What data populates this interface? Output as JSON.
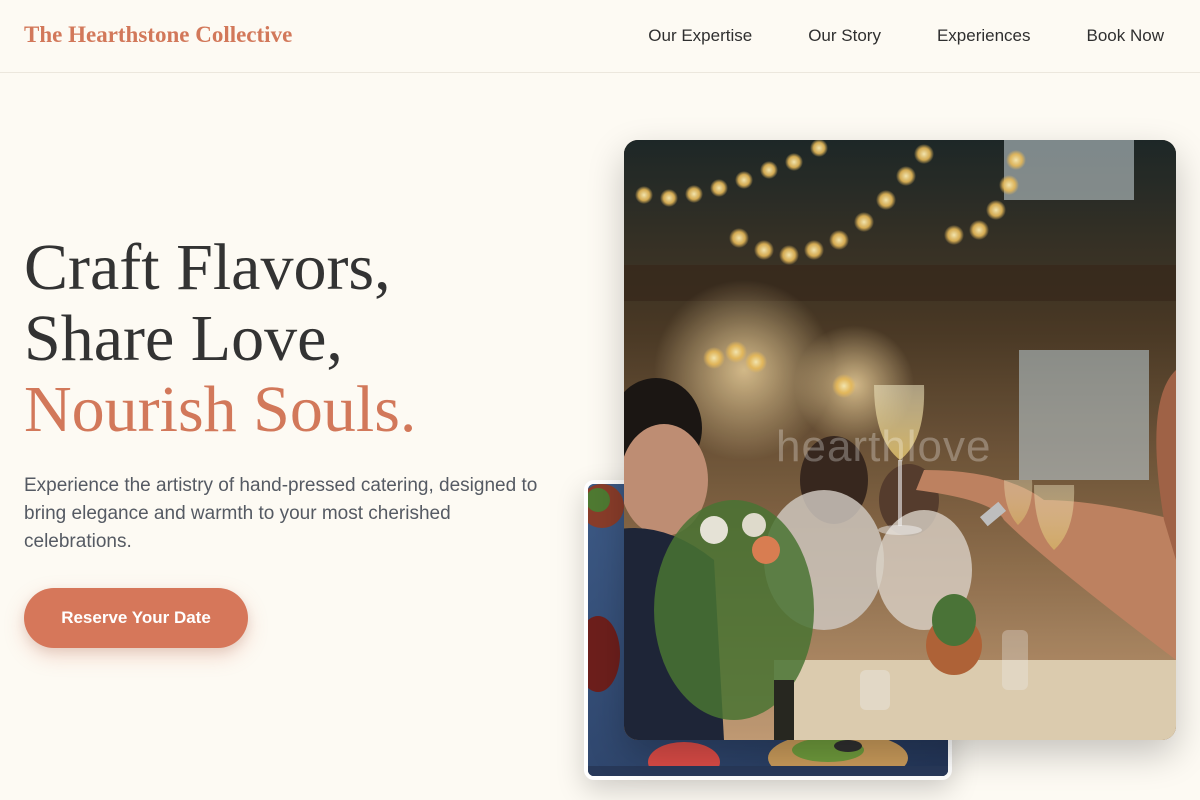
{
  "header": {
    "brand": "The Hearthstone Collective",
    "nav": [
      {
        "label": "Our Expertise"
      },
      {
        "label": "Our Story"
      },
      {
        "label": "Experiences"
      },
      {
        "label": "Book Now"
      }
    ]
  },
  "hero": {
    "title_line1": "Craft Flavors,",
    "title_line2": "Share Love,",
    "title_line3": "Nourish Souls.",
    "subtitle": "Experience the artistry of hand-pressed catering, designed to bring elegance and warmth to your most cherished celebrations.",
    "cta_label": "Reserve Your Date"
  },
  "images": {
    "main_watermark": "hearthlove"
  },
  "colors": {
    "accent": "#d2785a",
    "background": "#fdfaf3",
    "text": "#333333"
  }
}
